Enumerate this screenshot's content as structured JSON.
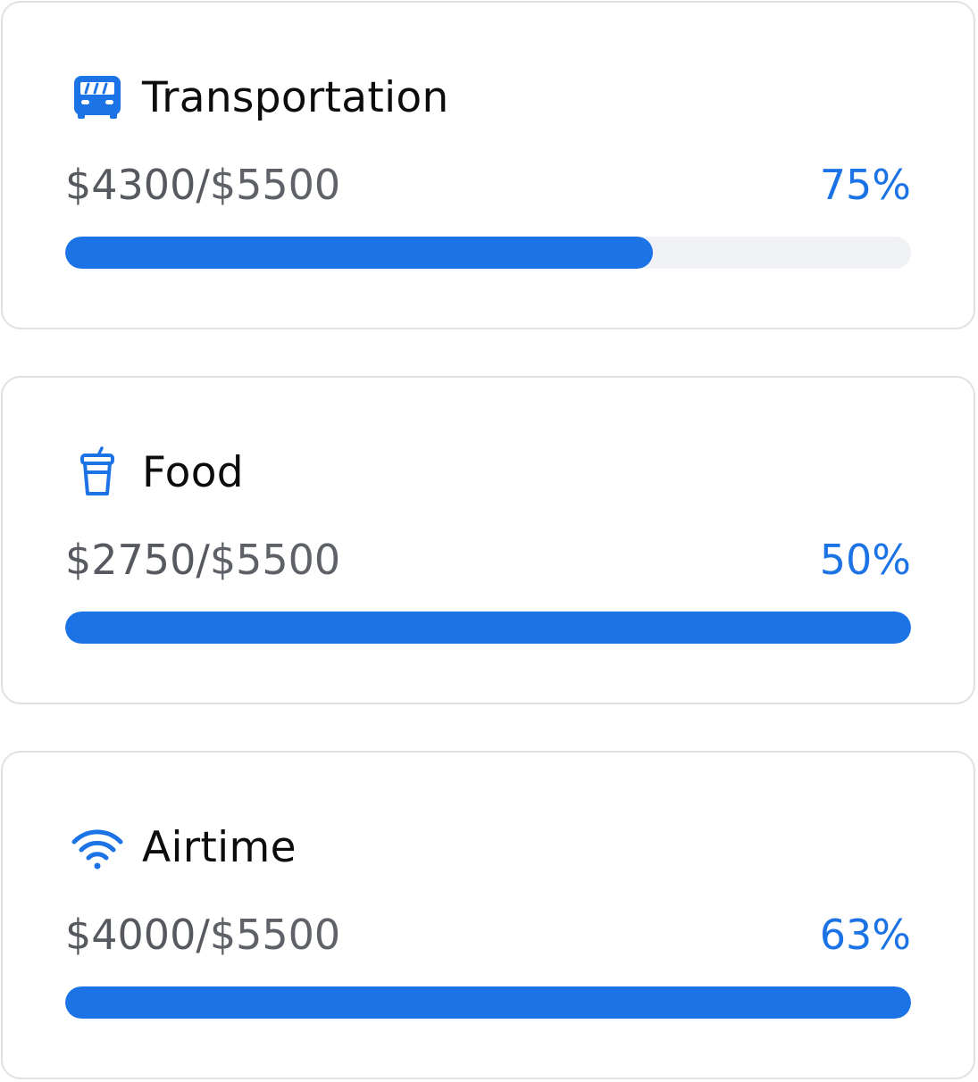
{
  "accent_color": "#1b73e6",
  "track_color": "#f1f2f6",
  "budgets": [
    {
      "icon": "bus-icon",
      "title": "Transportation",
      "spent": "$4300",
      "separator": "/",
      "total": "$5500",
      "percent_label": "75%",
      "progress_fill": 0.695
    },
    {
      "icon": "drink-cup-icon",
      "title": "Food",
      "spent": "$2750",
      "separator": "/",
      "total": "$5500",
      "percent_label": "50%",
      "progress_fill": 1.0
    },
    {
      "icon": "wifi-icon",
      "title": "Airtime",
      "spent": "$4000",
      "separator": "/",
      "total": "$5500",
      "percent_label": "63%",
      "progress_fill": 1.0
    }
  ]
}
